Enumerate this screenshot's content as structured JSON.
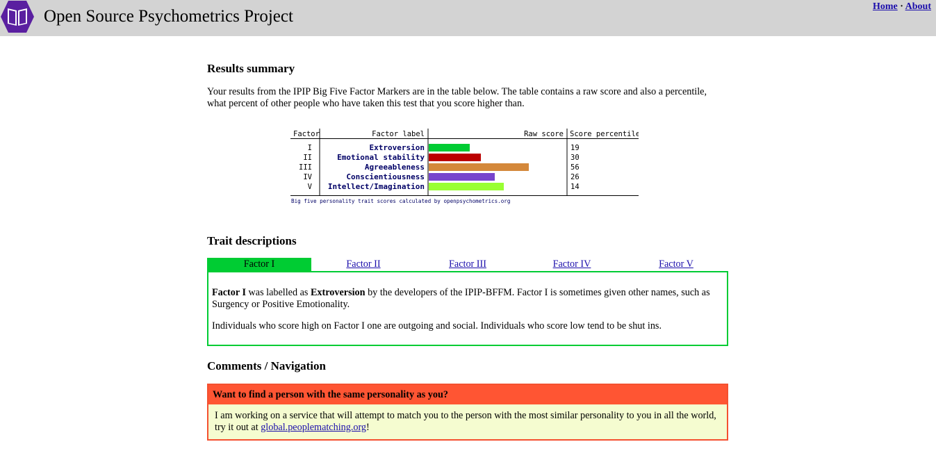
{
  "header": {
    "site_title": "Open Source Psychometrics Project",
    "nav": {
      "home": "Home",
      "separator": "·",
      "about": "About"
    },
    "logo_icon": "book-icon",
    "colors": {
      "background": "#d3d3d3",
      "logo": "#5a1fa0"
    }
  },
  "results": {
    "heading": "Results summary",
    "intro": "Your results from the IPIP Big Five Factor Markers are in the table below. The table contains a raw score and also a percentile, what percent of other people who have taken this test that you score higher than."
  },
  "chart_data": {
    "type": "bar",
    "headers": {
      "factor": "Factor",
      "label": "Factor label",
      "raw": "Raw score",
      "percentile": "Score percentile"
    },
    "factors": [
      "I",
      "II",
      "III",
      "IV",
      "V"
    ],
    "categories": [
      "Extroversion",
      "Emotional stability",
      "Agreeableness",
      "Conscientiousness",
      "Intellect/Imagination"
    ],
    "values": [
      19,
      30,
      56,
      26,
      14
    ],
    "raw_bar_fraction": [
      0.3,
      0.38,
      0.73,
      0.48,
      0.55
    ],
    "colors": [
      "#00cc33",
      "#bb0000",
      "#d4883a",
      "#7744cc",
      "#99ff33"
    ],
    "footer": "Big five personality trait scores calculated by openpsychometrics.org"
  },
  "traits": {
    "heading": "Trait descriptions",
    "tabs": [
      "Factor I",
      "Factor II",
      "Factor III",
      "Factor IV",
      "Factor V"
    ],
    "active_color": "#00cc33",
    "p1_bold1": "Factor I",
    "p1_text1": " was labelled as ",
    "p1_bold2": "Extroversion",
    "p1_text2": " by the developers of the IPIP-BFFM. Factor I is sometimes given other names, such as Surgency or Positive Emotionality.",
    "p2": "Individuals who score high on Factor I one are outgoing and social. Individuals who score low tend to be shut ins."
  },
  "comments": {
    "heading": "Comments / Navigation",
    "notice_title": "Want to find a person with the same personality as you?",
    "notice_text": "I am working on a service that will attempt to match you to the person with the most similar personality to you in all the world, try it out at ",
    "notice_link": "global.peoplematching.org",
    "notice_end": "!",
    "colors": {
      "header": "#ff5533",
      "body": "#f5fcd0"
    }
  }
}
